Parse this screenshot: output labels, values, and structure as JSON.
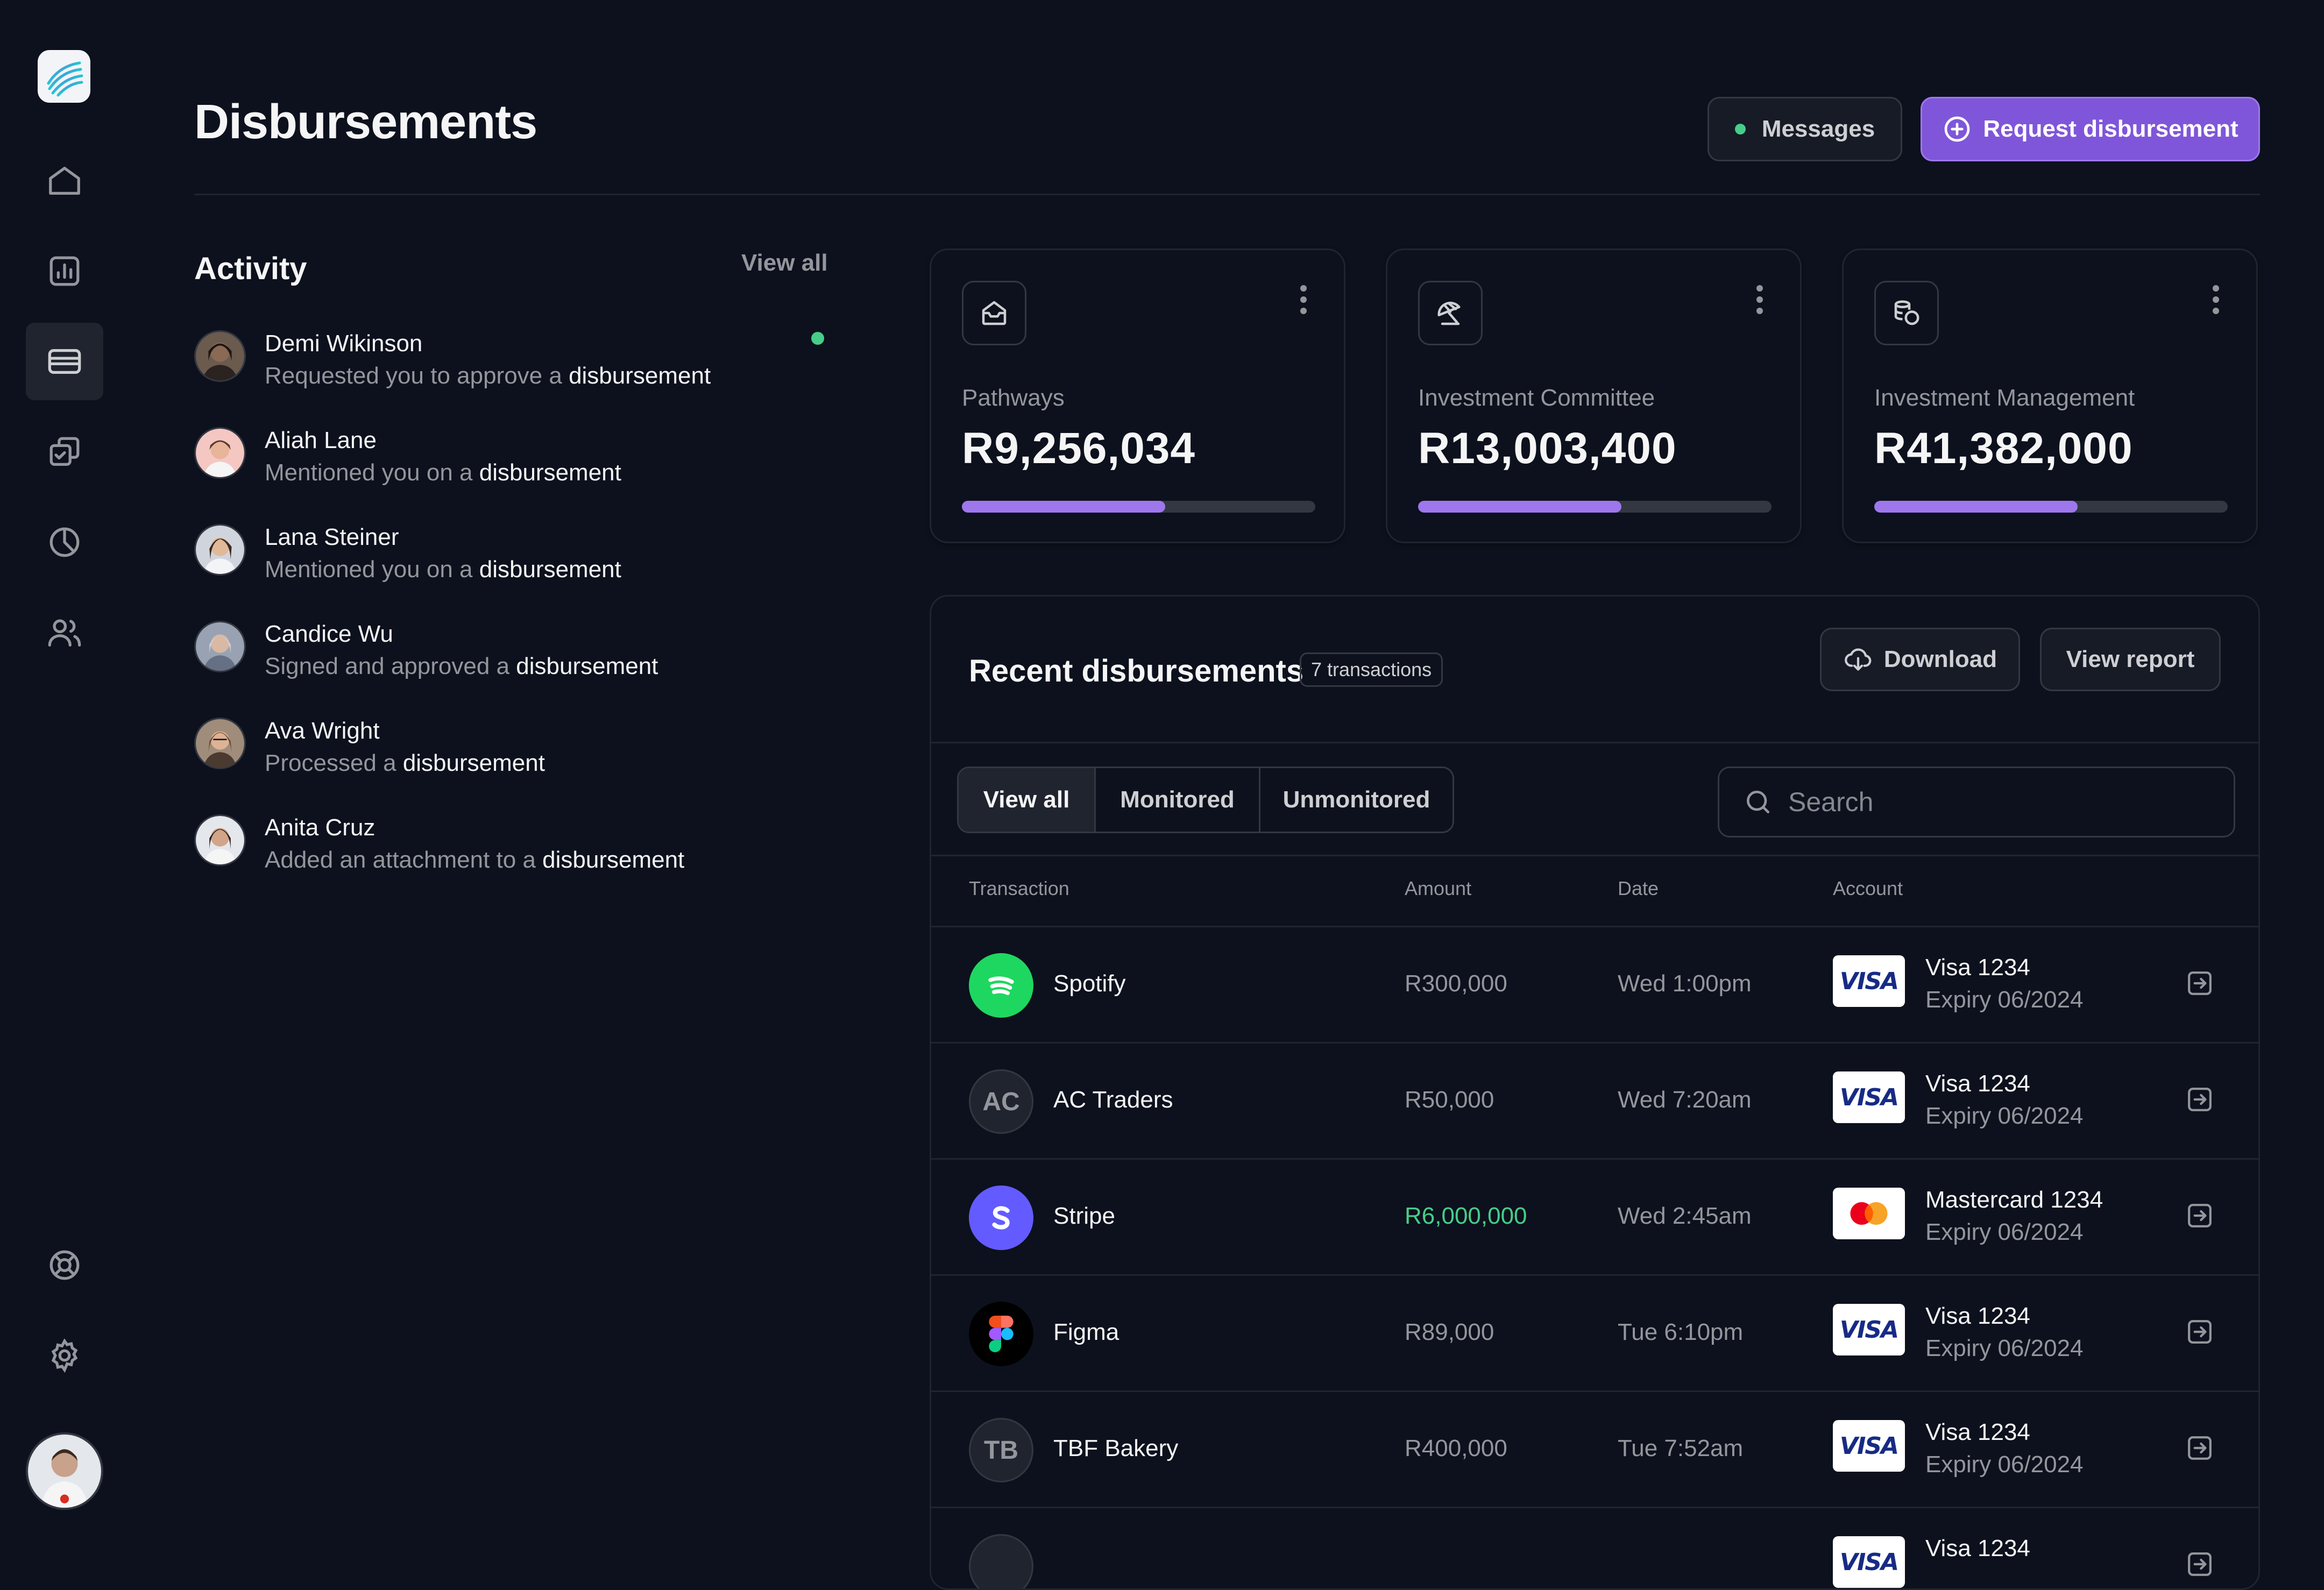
{
  "page": {
    "title": "Disbursements"
  },
  "header": {
    "messages_label": "Messages",
    "request_label": "Request disbursement"
  },
  "activity": {
    "title": "Activity",
    "view_all": "View all",
    "items": [
      {
        "name": "Demi Wikinson",
        "prefix": "Requested you to approve a ",
        "object": "disbursement",
        "unread": true
      },
      {
        "name": "Aliah Lane",
        "prefix": "Mentioned you on a ",
        "object": "disbursement"
      },
      {
        "name": "Lana Steiner",
        "prefix": "Mentioned you on a ",
        "object": "disbursement"
      },
      {
        "name": "Candice Wu",
        "prefix": "Signed and approved a ",
        "object": "disbursement"
      },
      {
        "name": "Ava Wright",
        "prefix": "Processed a ",
        "object": "disbursement"
      },
      {
        "name": "Anita Cruz",
        "prefix": "Added an attachment to a ",
        "object": "disbursement"
      }
    ]
  },
  "metrics": [
    {
      "label": "Pathways",
      "value": "R9,256,034",
      "progress": 0.575,
      "icon": "inbox-icon"
    },
    {
      "label": "Investment Committee",
      "value": "R13,003,400",
      "progress": 0.575,
      "icon": "umbrella-icon"
    },
    {
      "label": "Investment Management",
      "value": "R41,382,000",
      "progress": 0.575,
      "icon": "coins-icon"
    }
  ],
  "recent": {
    "title": "Recent disbursements",
    "badge": "7 transactions",
    "download_label": "Download",
    "view_report_label": "View report",
    "filters": [
      "View all",
      "Monitored",
      "Unmonitored"
    ],
    "active_filter": "View all",
    "search_placeholder": "Search",
    "columns": {
      "transaction": "Transaction",
      "amount": "Amount",
      "date": "Date",
      "account": "Account"
    },
    "rows": [
      {
        "name": "Spotify",
        "logo": "spotify-logo",
        "amount": "R300,000",
        "date": "Wed 1:00pm",
        "card_brand": "VISA",
        "account": "Visa 1234",
        "expiry": "Expiry 06/2024"
      },
      {
        "name": "AC Traders",
        "initials": "AC",
        "amount": "R50,000",
        "date": "Wed 7:20am",
        "card_brand": "VISA",
        "account": "Visa 1234",
        "expiry": "Expiry 06/2024"
      },
      {
        "name": "Stripe",
        "logo": "stripe-logo",
        "amount": "R6,000,000",
        "amount_positive": true,
        "date": "Wed 2:45am",
        "card_brand": "mastercard",
        "account": "Mastercard 1234",
        "expiry": "Expiry 06/2024"
      },
      {
        "name": "Figma",
        "logo": "figma-logo",
        "amount": "R89,000",
        "date": "Tue 6:10pm",
        "card_brand": "VISA",
        "account": "Visa 1234",
        "expiry": "Expiry 06/2024"
      },
      {
        "name": "TBF Bakery",
        "initials": "TB",
        "amount": "R400,000",
        "date": "Tue 7:52am",
        "card_brand": "VISA",
        "account": "Visa 1234",
        "expiry": "Expiry 06/2024"
      },
      {
        "card_brand": "VISA",
        "account": "Visa 1234"
      }
    ]
  },
  "colors": {
    "background": "#0c111d",
    "accent": "#7f56d9",
    "success": "#47cd89",
    "border": "#1f242f"
  }
}
